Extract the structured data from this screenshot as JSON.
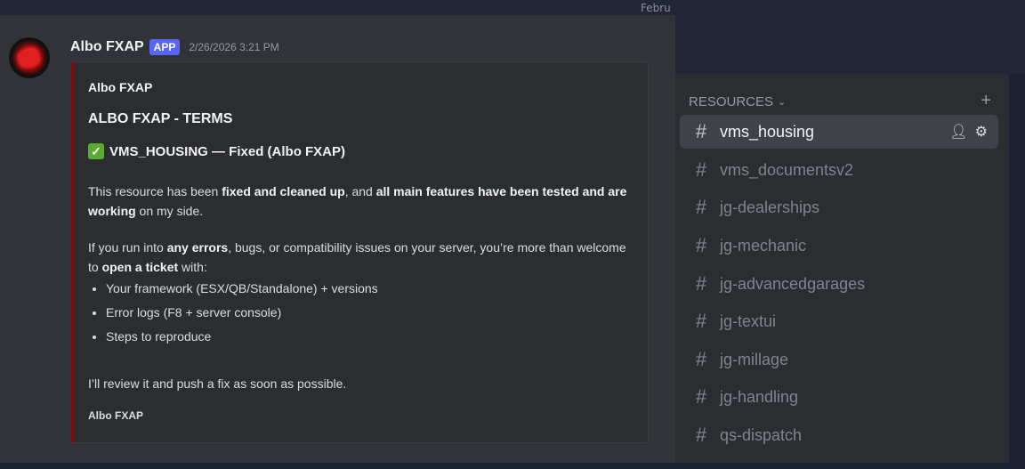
{
  "top": {
    "date_fragment": "Febru"
  },
  "message": {
    "username": "Albo FXAP",
    "badge": "APP",
    "timestamp": "2/26/2026 3:21 PM",
    "embed": {
      "author": "Albo FXAP",
      "title": "ALBO FXAP - TERMS",
      "subtitle_icon": "check-mark-button-emoji",
      "subtitle": "VMS_HOUSING — Fixed (Albo FXAP)",
      "p1_a": "This resource has been ",
      "p1_b": "fixed and cleaned up",
      "p1_c": ", and ",
      "p1_d": "all main features have been tested and are working",
      "p1_e": " on my side.",
      "p2_a": "If you run into ",
      "p2_b": "any errors",
      "p2_c": ", bugs, or compatibility issues on your server, you’re more than welcome to ",
      "p2_d": "open a ticket",
      "p2_e": " with:",
      "bullets": [
        "Your framework (ESX/QB/Standalone) + versions",
        "Error logs (F8 + server console)",
        "Steps to reproduce"
      ],
      "p3": "I’ll review it and push a fix as soon as possible.",
      "footer": "Albo FXAP"
    }
  },
  "sidebar": {
    "category": "RESOURCES",
    "channels": [
      {
        "name": "vms_housing",
        "active": true
      },
      {
        "name": "vms_documentsv2"
      },
      {
        "name": "jg-dealerships"
      },
      {
        "name": "jg-mechanic"
      },
      {
        "name": "jg-advancedgarages"
      },
      {
        "name": "jg-textui"
      },
      {
        "name": "jg-millage"
      },
      {
        "name": "jg-handling"
      },
      {
        "name": "qs-dispatch"
      }
    ]
  }
}
